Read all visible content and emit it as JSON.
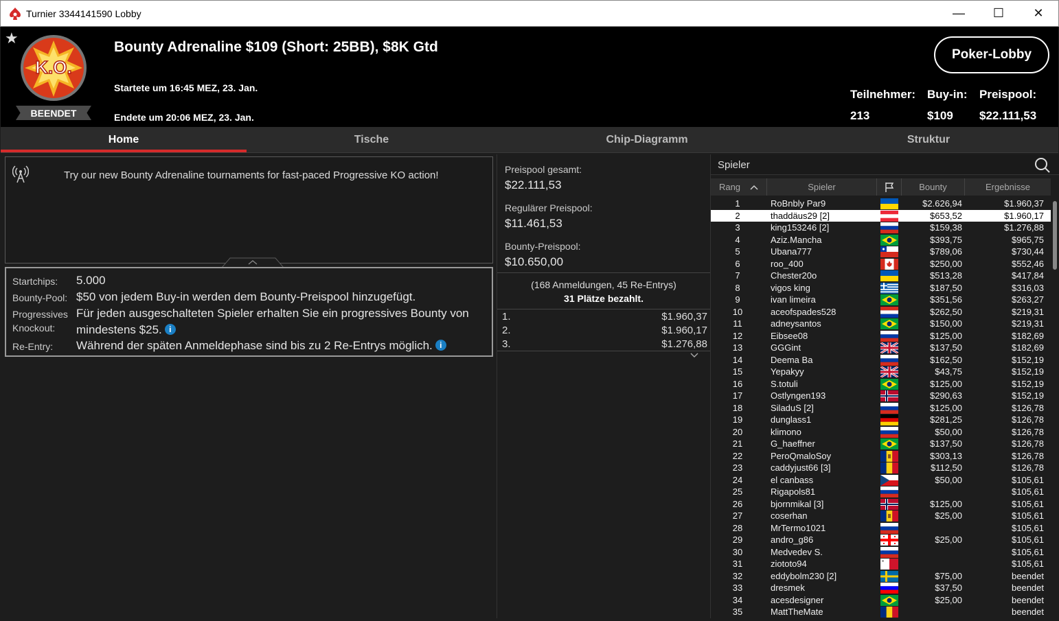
{
  "window": {
    "title": "Turnier 3344141590 Lobby",
    "minimize": "—",
    "maximize": "☐",
    "close": "✕"
  },
  "header": {
    "logo_text": "K.O.",
    "status": "BEENDET",
    "tournament_name": "Bounty Adrenaline $109 (Short: 25BB), $8K Gtd",
    "started": "Startete um 16:45 MEZ, 23. Jan.",
    "ended": "Endete um 20:06 MEZ, 23. Jan.",
    "lobby_button": "Poker-Lobby",
    "stats": {
      "entrants_label": "Teilnehmer:",
      "entrants_value": "213",
      "buyin_label": "Buy-in:",
      "buyin_value": "$109",
      "prizepool_label": "Preispool:",
      "prizepool_value": "$22.111,53"
    }
  },
  "tabs": [
    {
      "label": "Home",
      "active": true
    },
    {
      "label": "Tische",
      "active": false
    },
    {
      "label": "Chip-Diagramm",
      "active": false
    },
    {
      "label": "Struktur",
      "active": false
    }
  ],
  "promo": {
    "text": "Try our new Bounty Adrenaline tournaments for fast-paced Progressive KO action!"
  },
  "info": {
    "startchips_label": "Startchips:",
    "startchips_value": "5.000",
    "bountypool_label": "Bounty-Pool:",
    "bountypool_value": "$50 von jedem Buy-in werden dem Bounty-Preispool hinzugefügt.",
    "progressive_label1": "Progressives",
    "progressive_label2": "Knockout:",
    "progressive_value1": "Für jeden ausgeschalteten Spieler erhalten Sie ein progressives Bounty von",
    "progressive_value2": "mindestens $25.",
    "reentry_label": "Re-Entry:",
    "reentry_value": "Während der späten Anmeldephase sind bis zu 2 Re-Entrys möglich.",
    "info_glyph": "i"
  },
  "prizes": {
    "total_label": "Preispool gesamt:",
    "total_value": "$22.111,53",
    "regular_label": "Regulärer Preispool:",
    "regular_value": "$11.461,53",
    "bounty_label": "Bounty-Preispool:",
    "bounty_value": "$10.650,00",
    "registrations": "(168 Anmeldungen, 45 Re-Entrys)",
    "paid": "31 Plätze bezahlt.",
    "payouts": [
      {
        "pos": "1.",
        "amount": "$1.960,37"
      },
      {
        "pos": "2.",
        "amount": "$1.960,17"
      },
      {
        "pos": "3.",
        "amount": "$1.276,88"
      }
    ]
  },
  "players": {
    "search_placeholder": "Spieler",
    "headers": {
      "rank": "Rang",
      "player": "Spieler",
      "bounty": "Bounty",
      "result": "Ergebnisse"
    },
    "rows": [
      {
        "rank": "1",
        "name": "RoBnbly Par9",
        "flag": "ua",
        "bounty": "$2.626,94",
        "result": "$1.960,37"
      },
      {
        "rank": "2",
        "name": "thaddäus29 [2]",
        "flag": "at",
        "bounty": "$653,52",
        "result": "$1.960,17",
        "selected": true
      },
      {
        "rank": "3",
        "name": "king153246 [2]",
        "flag": "ru",
        "bounty": "$159,38",
        "result": "$1.276,88"
      },
      {
        "rank": "4",
        "name": "Aziz.Mancha",
        "flag": "br",
        "bounty": "$393,75",
        "result": "$965,75"
      },
      {
        "rank": "5",
        "name": "Ubana777",
        "flag": "cl",
        "bounty": "$789,06",
        "result": "$730,44"
      },
      {
        "rank": "6",
        "name": "roo_400",
        "flag": "ca",
        "bounty": "$250,00",
        "result": "$552,46"
      },
      {
        "rank": "7",
        "name": "Chester20o",
        "flag": "ua",
        "bounty": "$513,28",
        "result": "$417,84"
      },
      {
        "rank": "8",
        "name": "vigos king",
        "flag": "gr",
        "bounty": "$187,50",
        "result": "$316,03"
      },
      {
        "rank": "9",
        "name": "ivan limeira",
        "flag": "br",
        "bounty": "$351,56",
        "result": "$263,27"
      },
      {
        "rank": "10",
        "name": "aceofspades528",
        "flag": "py",
        "bounty": "$262,50",
        "result": "$219,31"
      },
      {
        "rank": "11",
        "name": "adneysantos",
        "flag": "br",
        "bounty": "$150,00",
        "result": "$219,31"
      },
      {
        "rank": "12",
        "name": "Eibsee08",
        "flag": "ru",
        "bounty": "$125,00",
        "result": "$182,69"
      },
      {
        "rank": "13",
        "name": "GGGint",
        "flag": "gb",
        "bounty": "$137,50",
        "result": "$182,69"
      },
      {
        "rank": "14",
        "name": "Deema Ba",
        "flag": "ru",
        "bounty": "$162,50",
        "result": "$152,19"
      },
      {
        "rank": "15",
        "name": "Yepakyy",
        "flag": "gb",
        "bounty": "$43,75",
        "result": "$152,19"
      },
      {
        "rank": "16",
        "name": "S.totuli",
        "flag": "br",
        "bounty": "$125,00",
        "result": "$152,19"
      },
      {
        "rank": "17",
        "name": "Ostlyngen193",
        "flag": "no",
        "bounty": "$290,63",
        "result": "$152,19"
      },
      {
        "rank": "18",
        "name": "SiladuS [2]",
        "flag": "ru",
        "bounty": "$125,00",
        "result": "$126,78"
      },
      {
        "rank": "19",
        "name": "dunglass1",
        "flag": "de",
        "bounty": "$281,25",
        "result": "$126,78"
      },
      {
        "rank": "20",
        "name": "klimono",
        "flag": "ru",
        "bounty": "$50,00",
        "result": "$126,78"
      },
      {
        "rank": "21",
        "name": "G_haeffner",
        "flag": "br",
        "bounty": "$137,50",
        "result": "$126,78"
      },
      {
        "rank": "22",
        "name": "PeroQmaloSoy",
        "flag": "md",
        "bounty": "$303,13",
        "result": "$126,78"
      },
      {
        "rank": "23",
        "name": "caddyjust66 [3]",
        "flag": "ro",
        "bounty": "$112,50",
        "result": "$126,78"
      },
      {
        "rank": "24",
        "name": "el canbass",
        "flag": "cz",
        "bounty": "$50,00",
        "result": "$105,61"
      },
      {
        "rank": "25",
        "name": "Rigapols81",
        "flag": "ru",
        "bounty": "",
        "result": "$105,61"
      },
      {
        "rank": "26",
        "name": "bjornmikal [3]",
        "flag": "no",
        "bounty": "$125,00",
        "result": "$105,61"
      },
      {
        "rank": "27",
        "name": "coserhan",
        "flag": "md",
        "bounty": "$25,00",
        "result": "$105,61"
      },
      {
        "rank": "28",
        "name": "MrTermo1021",
        "flag": "ru",
        "bounty": "",
        "result": "$105,61"
      },
      {
        "rank": "29",
        "name": "andro_g86",
        "flag": "ge",
        "bounty": "$25,00",
        "result": "$105,61"
      },
      {
        "rank": "30",
        "name": "Medvedev S.",
        "flag": "ru",
        "bounty": "",
        "result": "$105,61"
      },
      {
        "rank": "31",
        "name": "ziototo94",
        "flag": "mt",
        "bounty": "",
        "result": "$105,61"
      },
      {
        "rank": "32",
        "name": "eddybolm230 [2]",
        "flag": "se",
        "bounty": "$75,00",
        "result": "beendet"
      },
      {
        "rank": "33",
        "name": "dresmek",
        "flag": "si",
        "bounty": "$37,50",
        "result": "beendet"
      },
      {
        "rank": "34",
        "name": "acesdesigner",
        "flag": "br",
        "bounty": "$25,00",
        "result": "beendet"
      },
      {
        "rank": "35",
        "name": "MattTheMate",
        "flag": "ro",
        "bounty": "",
        "result": "beendet"
      }
    ]
  },
  "colors": {
    "accent_red": "#d62b2b",
    "background": "#1d1d1d",
    "header_bg": "#000000",
    "info_blue": "#1a7fc4"
  }
}
